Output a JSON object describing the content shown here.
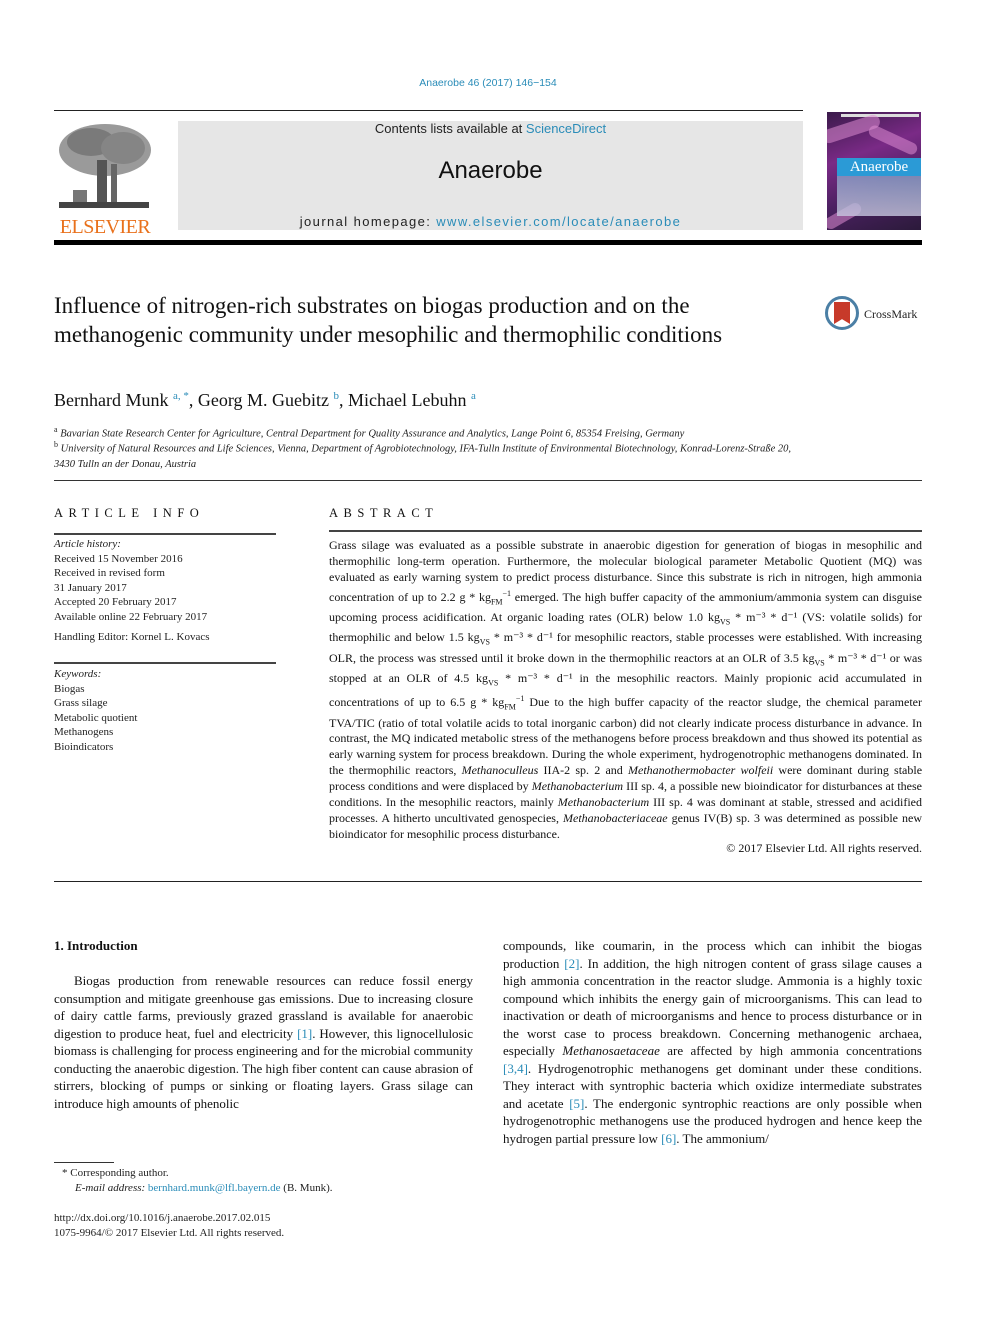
{
  "header": {
    "journal_ref": "Anaerobe 46 (2017) 146−154",
    "contents_prefix": "Contents lists available at ",
    "contents_link": "ScienceDirect",
    "journal_title": "Anaerobe",
    "homepage_prefix": "journal homepage: ",
    "homepage_link": "www.elsevier.com/locate/anaerobe",
    "publisher_logo_text": "ELSEVIER",
    "cover_title": "Anaerobe",
    "crossmark_label": "CrossMark"
  },
  "colors": {
    "link": "#2a8cb8",
    "elsevier_orange": "#e9711c",
    "masthead_bg": "#e6e6e6",
    "cover_banner": "#2b9ad6",
    "crossmark_red": "#c73a2a"
  },
  "article": {
    "title": "Influence of nitrogen-rich substrates on biogas production and on the methanogenic community under mesophilic and thermophilic conditions",
    "authors": [
      {
        "name": "Bernhard Munk",
        "sup": "a, *"
      },
      {
        "name": "Georg M. Guebitz",
        "sup": "b"
      },
      {
        "name": "Michael Lebuhn",
        "sup": "a"
      }
    ],
    "affiliations": [
      {
        "sup": "a",
        "text": "Bavarian State Research Center for Agriculture, Central Department for Quality Assurance and Analytics, Lange Point 6, 85354 Freising, Germany"
      },
      {
        "sup": "b",
        "text": "University of Natural Resources and Life Sciences, Vienna, Department of Agrobiotechnology, IFA-Tulln Institute of Environmental Biotechnology, Konrad-Lorenz-Straße 20, 3430 Tulln an der Donau, Austria"
      }
    ]
  },
  "article_info": {
    "heading": "ARTICLE INFO",
    "history_label": "Article history:",
    "history": [
      "Received 15 November 2016",
      "Received in revised form",
      "31 January 2017",
      "Accepted 20 February 2017",
      "Available online 22 February 2017"
    ],
    "handling_editor": "Handling Editor: Kornel L. Kovacs",
    "keywords_label": "Keywords:",
    "keywords": [
      "Biogas",
      "Grass silage",
      "Metabolic quotient",
      "Methanogens",
      "Bioindicators"
    ]
  },
  "abstract": {
    "heading": "ABSTRACT",
    "p1": "Grass silage was evaluated as a possible substrate in anaerobic digestion for generation of biogas in mesophilic and thermophilic long-term operation. Furthermore, the molecular biological parameter Metabolic Quotient (MQ) was evaluated as early warning system to predict process disturbance. Since this substrate is rich in nitrogen, high ammonia concentration of up to 2.2 g * kg",
    "p2": " emerged. The high buffer capacity of the ammonium/ammonia system can disguise upcoming process acidification. At organic loading rates (OLR) below 1.0 kg",
    "p3": " (VS: volatile solids) for thermophilic and below 1.5 kg",
    "p4": " for mesophilic reactors, stable processes were established. With increasing OLR, the process was stressed until it broke down in the thermophilic reactors at an OLR of 3.5 kg",
    "p5": " or was stopped at an OLR of 4.5 kg",
    "p6": " in the mesophilic reactors. Mainly propionic acid accumulated in concentrations of up to 6.5 g * kg",
    "p7": " Due to the high buffer capacity of the reactor sludge, the chemical parameter TVA/TIC (ratio of total volatile acids to total inorganic carbon) did not clearly indicate process disturbance in advance. In contrast, the MQ indicated metabolic stress of the methanogens before process breakdown and thus showed its potential as early warning system for process breakdown. During the whole experiment, hydrogenotrophic methanogens dominated. In the thermophilic reactors, ",
    "sp1": "Methanoculleus",
    "p8": " IIA-2 sp. 2 and ",
    "sp2": "Methanothermobacter wolfeii",
    "p9": " were dominant during stable process conditions and were displaced by ",
    "sp3": "Methanobacterium",
    "p10": " III sp. 4, a possible new bioindicator for disturbances at these conditions. In the mesophilic reactors, mainly ",
    "sp4": "Methanobacterium",
    "p11": " III sp. 4 was dominant at stable, stressed and acidified processes. A hitherto uncultivated genospecies, ",
    "sp5": "Methanobacteriaceae",
    "p12": " genus IV(B) sp. 3 was determined as possible new bioindicator for mesophilic process disturbance.",
    "unit_fm": "FM",
    "unit_vs": "VS",
    "unit_rate": " * m⁻³ * d⁻¹",
    "unit_inv": "−1",
    "copyright": "© 2017 Elsevier Ltd. All rights reserved."
  },
  "body": {
    "section_heading": "1.  Introduction",
    "left": {
      "t1": "Biogas production from renewable resources can reduce fossil energy consumption and mitigate greenhouse gas emissions. Due to increasing closure of dairy cattle farms, previously grazed grassland is available for anaerobic digestion to produce heat, fuel and electricity ",
      "ref1": "[1]",
      "t2": ". However, this lignocellulosic biomass is challenging for process engineering and for the microbial community conducting the anaerobic digestion. The high fiber content can cause abrasion of stirrers, blocking of pumps or sinking or floating layers. Grass silage can introduce high amounts of phenolic"
    },
    "right": {
      "t1": "compounds, like coumarin, in the process which can inhibit the biogas production ",
      "ref2": "[2]",
      "t2": ". In addition, the high nitrogen content of grass silage causes a high ammonia concentration in the reactor sludge. Ammonia is a highly toxic compound which inhibits the energy gain of microorganisms. This can lead to inactivation or death of microorganisms and hence to process disturbance or in the worst case to process breakdown. Concerning methanogenic archaea, especially ",
      "sp": "Methanosaetaceae",
      "t3": " are affected by high ammonia concentrations ",
      "ref3": "[3,4]",
      "t4": ". Hydrogenotrophic methanogens get dominant under these conditions. They interact with syntrophic bacteria which oxidize intermediate substrates and acetate ",
      "ref5": "[5]",
      "t5": ". The endergonic syntrophic reactions are only possible when hydrogenotrophic methanogens use the produced hydrogen and hence keep the hydrogen partial pressure low ",
      "ref6": "[6]",
      "t6": ". The ammonium/"
    }
  },
  "footnotes": {
    "corresponding": "* Corresponding author.",
    "email_label": "E-mail address: ",
    "email": "bernhard.munk@lfl.bayern.de",
    "email_suffix": " (B. Munk).",
    "doi": "http://dx.doi.org/10.1016/j.anaerobe.2017.02.015",
    "issn_copyright": "1075-9964/© 2017 Elsevier Ltd. All rights reserved."
  }
}
